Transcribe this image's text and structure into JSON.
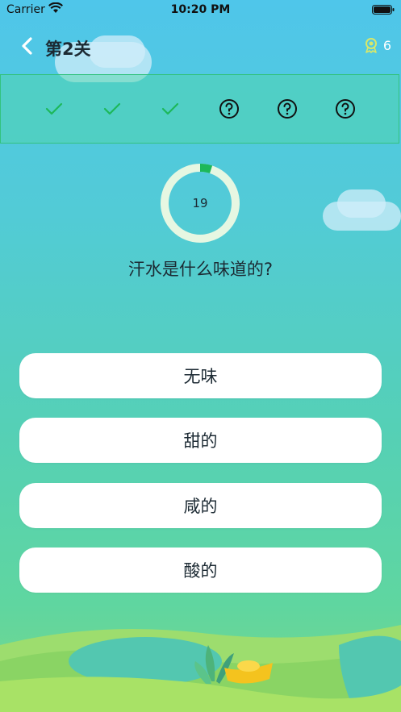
{
  "status": {
    "carrier": "Carrier",
    "time": "10:20 PM"
  },
  "nav": {
    "title": "第2关",
    "medal_count": "6"
  },
  "progress": {
    "steps": [
      {
        "state": "done"
      },
      {
        "state": "done"
      },
      {
        "state": "done"
      },
      {
        "state": "unknown"
      },
      {
        "state": "unknown"
      },
      {
        "state": "unknown"
      }
    ]
  },
  "timer": {
    "seconds": "19",
    "remaining_fraction": 0.95
  },
  "question": {
    "text": "汗水是什么味道的?"
  },
  "options": [
    {
      "label": "无味"
    },
    {
      "label": "甜的"
    },
    {
      "label": "咸的"
    },
    {
      "label": "酸的"
    }
  ],
  "colors": {
    "accent_green": "#1db85a",
    "ring_light": "#e6f7e2",
    "strip_border": "#33c27e"
  }
}
